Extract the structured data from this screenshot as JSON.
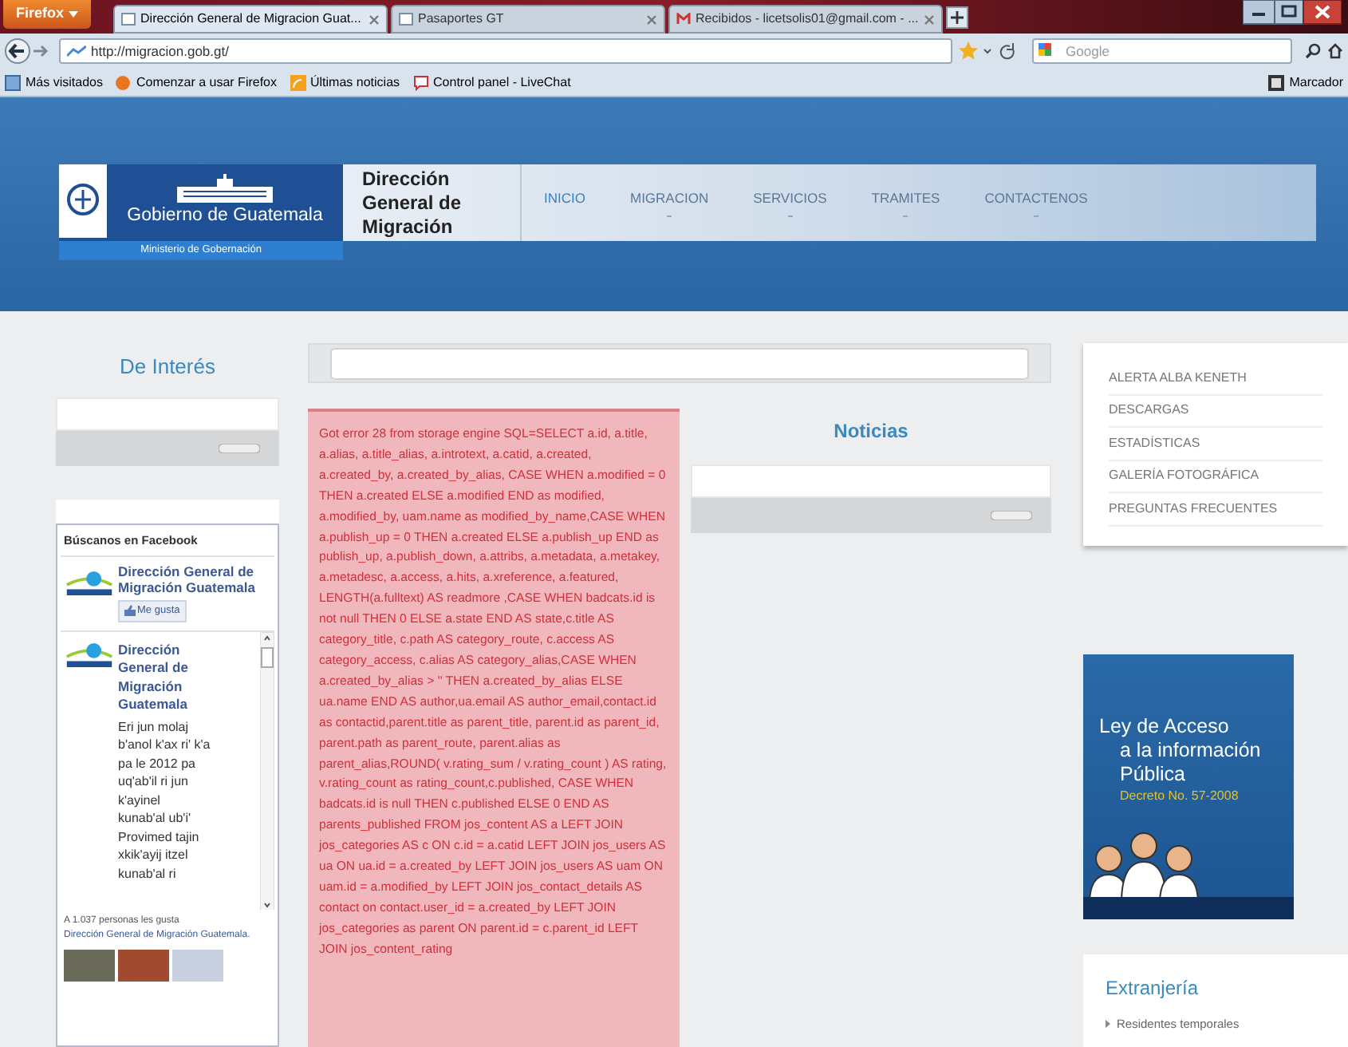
{
  "browser": {
    "menu_button": "Firefox",
    "tabs": [
      {
        "title": "Dirección General de Migracion Guat...",
        "selected": true
      },
      {
        "title": "Pasaportes GT",
        "selected": false
      },
      {
        "title": "Recibidos - licetsolis01@gmail.com - ...",
        "selected": false
      }
    ],
    "url": "http://migracion.gob.gt/",
    "search_placeholder": "Google",
    "bookmarks": [
      "Más visitados",
      "Comenzar a usar Firefox",
      "Últimas noticias",
      "Control panel - LiveChat"
    ],
    "bookmarks_menu": "Marcador"
  },
  "header": {
    "logo_title": "Gobierno de Guatemala",
    "logo_subtitle": "Ministerio de Gobernación",
    "site_title": "Dirección General de Migración",
    "nav": [
      {
        "label": "INICIO",
        "selected": true,
        "has_submenu": false
      },
      {
        "label": "MIGRACION",
        "selected": false,
        "has_submenu": true
      },
      {
        "label": "SERVICIOS",
        "selected": false,
        "has_submenu": true
      },
      {
        "label": "TRAMITES",
        "selected": false,
        "has_submenu": true
      },
      {
        "label": "CONTACTENOS",
        "selected": false,
        "has_submenu": true
      }
    ]
  },
  "left": {
    "heading": "De Interés",
    "facebook": {
      "title": "Búscanos en Facebook",
      "page_name": "Dirección General de Migración Guatemala",
      "like_button": "Me gusta",
      "post_author": "Dirección General de Migración Guatemala",
      "post_text": "Eri jun molaj b'anol k'ax ri' k'a pa le 2012 pa uq'ab'il ri jun k'ayinel kunab'al ub'i' Provimed tajin xkik'ayij itzel kunab'al ri",
      "likes_prefix": "A 1.037 personas les gusta",
      "likes_link": "Dirección General de Migración Guatemala",
      "likes_suffix": "."
    }
  },
  "center": {
    "error_message": "Got error 28 from storage engine SQL=SELECT a.id, a.title, a.alias, a.title_alias, a.introtext, a.catid, a.created, a.created_by, a.created_by_alias, CASE WHEN a.modified = 0 THEN a.created ELSE a.modified END as modified, a.modified_by, uam.name as modified_by_name,CASE WHEN a.publish_up = 0 THEN a.created ELSE a.publish_up END as publish_up, a.publish_down, a.attribs, a.metadata, a.metakey, a.metadesc, a.access, a.hits, a.xreference, a.featured, LENGTH(a.fulltext) AS readmore ,CASE WHEN badcats.id is not null THEN 0 ELSE a.state END AS state,c.title AS category_title, c.path AS category_route, c.access AS category_access, c.alias AS category_alias,CASE WHEN a.created_by_alias > '' THEN a.created_by_alias ELSE ua.name END AS author,ua.email AS author_email,contact.id as contactid,parent.title as parent_title, parent.id as parent_id, parent.path as parent_route, parent.alias as parent_alias,ROUND( v.rating_sum / v.rating_count ) AS rating, v.rating_count as rating_count,c.published, CASE WHEN badcats.id is null THEN c.published ELSE 0 END AS parents_published FROM jos_content AS a LEFT JOIN jos_categories AS c ON c.id = a.catid LEFT JOIN jos_users AS ua ON ua.id = a.created_by LEFT JOIN jos_users AS uam ON uam.id = a.modified_by LEFT JOIN jos_contact_details AS contact on contact.user_id = a.created_by LEFT JOIN jos_categories as parent ON parent.id = c.parent_id LEFT JOIN jos_content_rating",
    "news_heading": "Noticias"
  },
  "right": {
    "menu": [
      "ALERTA ALBA KENETH",
      "DESCARGAS",
      "ESTADÍSTICAS",
      "GALERÍA FOTOGRÁFICA",
      "PREGUNTAS FRECUENTES"
    ],
    "banner": {
      "lines": [
        "Ley de Acceso",
        "a la información",
        "Pública"
      ],
      "decree": "Decreto No. 57-2008"
    },
    "extranjeria": {
      "heading": "Extranjería",
      "items": [
        "Residentes temporales"
      ]
    }
  }
}
